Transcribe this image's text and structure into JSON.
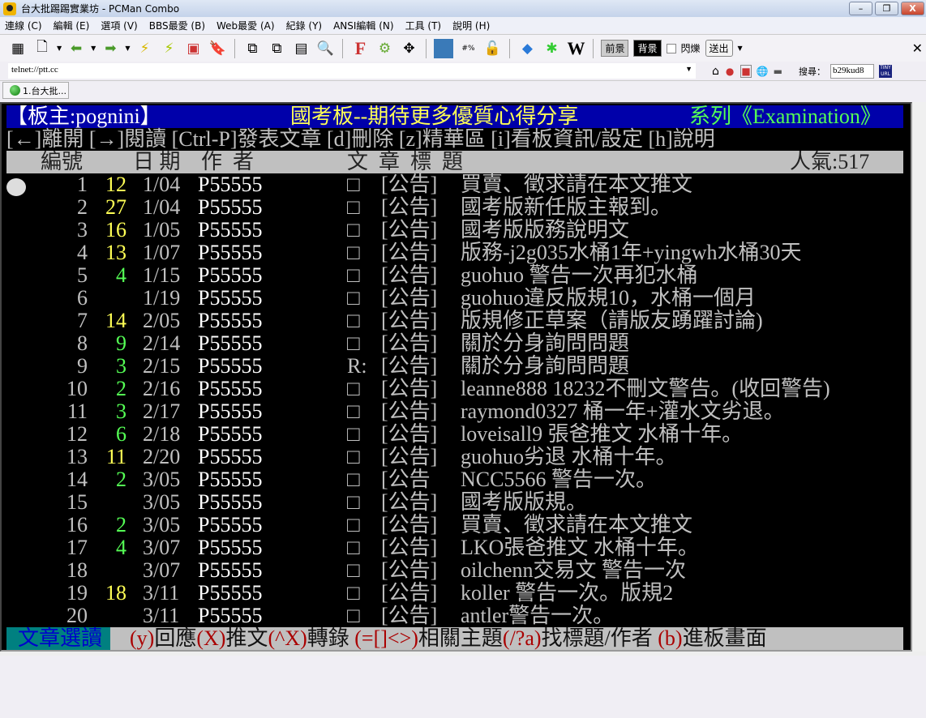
{
  "window": {
    "title": "台大批踢踢實業坊 - PCMan Combo",
    "minimize": "–",
    "restore": "❐",
    "close": "X"
  },
  "menu": [
    "連線 (C)",
    "編輯 (E)",
    "選項 (V)",
    "BBS最愛 (B)",
    "Web最愛 (A)",
    "紀錄 (Y)",
    "ANSI編輯 (N)",
    "工具 (T)",
    "說明 (H)"
  ],
  "toolbar": {
    "fg": "前景",
    "bg": "背景",
    "blink": "閃爍",
    "send": "送出",
    "close": "✕"
  },
  "address": {
    "value": "telnet://ptt.cc",
    "search_label": "搜尋：",
    "search_value": "b29kud8",
    "tinyurl": "TINY URL"
  },
  "tab": {
    "label": "1.台大批..."
  },
  "colors": {
    "bar_blue": "#0000aa",
    "push_high": "#ffff55",
    "push_low": "#55ff55",
    "footer_teal": "#008080",
    "footer_key": "#aa0000"
  },
  "terminal": {
    "header": {
      "moderator": "【板主:pognini】",
      "board_title": "國考板--期待更多優質心得分享",
      "series": "系列《Examination》"
    },
    "help": "[←]離開 [→]閱讀 [Ctrl-P]發表文章 [d]刪除 [z]精華區 [i]看板資訊/設定 [h]說明",
    "columns": {
      "num": "編號",
      "date": "日 期",
      "author": "作  者",
      "title": "文  章  標  題",
      "popularity": "人氣:517"
    },
    "rows": [
      {
        "num": "1",
        "push": "12",
        "date": "1/04",
        "author": "P55555",
        "mark": "□",
        "tag": "[公告]",
        "title": "買賣、徵求請在本文推文"
      },
      {
        "num": "2",
        "push": "27",
        "date": "1/04",
        "author": "P55555",
        "mark": "□",
        "tag": "[公告]",
        "title": "國考版新任版主報到。"
      },
      {
        "num": "3",
        "push": "16",
        "date": "1/05",
        "author": "P55555",
        "mark": "□",
        "tag": "[公告]",
        "title": "國考版版務說明文"
      },
      {
        "num": "4",
        "push": "13",
        "date": "1/07",
        "author": "P55555",
        "mark": "□",
        "tag": "[公告]",
        "title": "版務-j2g035水桶1年+yingwh水桶30天"
      },
      {
        "num": "5",
        "push": "4",
        "date": "1/15",
        "author": "P55555",
        "mark": "□",
        "tag": "[公告]",
        "title": "guohuo 警告一次再犯水桶"
      },
      {
        "num": "6",
        "push": "",
        "date": "1/19",
        "author": "P55555",
        "mark": "□",
        "tag": "[公告]",
        "title": "guohuo違反版規10，水桶一個月"
      },
      {
        "num": "7",
        "push": "14",
        "date": "2/05",
        "author": "P55555",
        "mark": "□",
        "tag": "[公告]",
        "title": "版規修正草案（請版友踴躍討論)"
      },
      {
        "num": "8",
        "push": "9",
        "date": "2/14",
        "author": "P55555",
        "mark": "□",
        "tag": "[公告]",
        "title": "關於分身詢問問題"
      },
      {
        "num": "9",
        "push": "3",
        "date": "2/15",
        "author": "P55555",
        "mark": "R:",
        "tag": "[公告]",
        "title": "關於分身詢問問題"
      },
      {
        "num": "10",
        "push": "2",
        "date": "2/16",
        "author": "P55555",
        "mark": "□",
        "tag": "[公告]",
        "title": "leanne888 18232不刪文警告。(收回警告)"
      },
      {
        "num": "11",
        "push": "3",
        "date": "2/17",
        "author": "P55555",
        "mark": "□",
        "tag": "[公告]",
        "title": "raymond0327 桶一年+灌水文劣退。"
      },
      {
        "num": "12",
        "push": "6",
        "date": "2/18",
        "author": "P55555",
        "mark": "□",
        "tag": "[公告]",
        "title": "loveisall9 張爸推文 水桶十年。"
      },
      {
        "num": "13",
        "push": "11",
        "date": "2/20",
        "author": "P55555",
        "mark": "□",
        "tag": "[公告]",
        "title": "guohuo劣退 水桶十年。"
      },
      {
        "num": "14",
        "push": "2",
        "date": "3/05",
        "author": "P55555",
        "mark": "□",
        "tag": "[公告",
        "title": "NCC5566 警告一次。"
      },
      {
        "num": "15",
        "push": "",
        "date": "3/05",
        "author": "P55555",
        "mark": "□",
        "tag": "[公告]",
        "title": "國考版版規。"
      },
      {
        "num": "16",
        "push": "2",
        "date": "3/05",
        "author": "P55555",
        "mark": "□",
        "tag": "[公告]",
        "title": "買賣、徵求請在本文推文"
      },
      {
        "num": "17",
        "push": "4",
        "date": "3/07",
        "author": "P55555",
        "mark": "□",
        "tag": "[公告]",
        "title": "LKO張爸推文 水桶十年。"
      },
      {
        "num": "18",
        "push": "",
        "date": "3/07",
        "author": "P55555",
        "mark": "□",
        "tag": "[公告]",
        "title": "oilchenn交易文 警告一次"
      },
      {
        "num": "19",
        "push": "18",
        "date": "3/11",
        "author": "P55555",
        "mark": "□",
        "tag": "[公告]",
        "title": "koller 警告一次。版規2"
      },
      {
        "num": "20",
        "push": "",
        "date": "3/11",
        "author": "P55555",
        "mark": "□",
        "tag": "[公告]",
        "title": "antler警告一次。"
      }
    ],
    "footer": {
      "label": "文章選讀",
      "items": [
        {
          "key": "(y)",
          "text": "回應"
        },
        {
          "key": "(X)",
          "text": "推文"
        },
        {
          "key": "(^X)",
          "text": "轉錄 "
        },
        {
          "key": "(=[]<>)",
          "text": "相關主題"
        },
        {
          "key": "(/?a)",
          "text": "找標題/作者 "
        },
        {
          "key": "(b)",
          "text": "進板畫面"
        }
      ]
    }
  }
}
